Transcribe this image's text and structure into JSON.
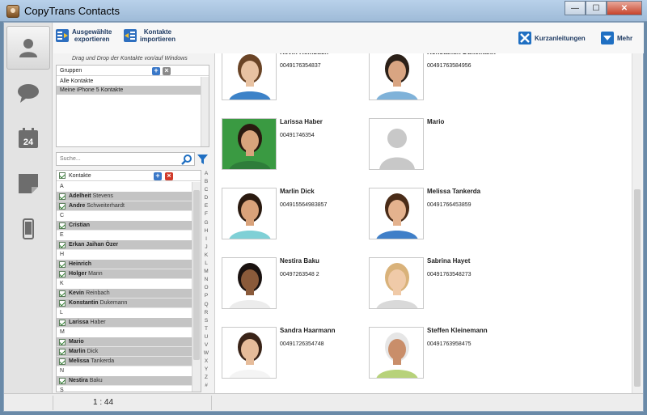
{
  "window": {
    "title": "CopyTrans Contacts"
  },
  "toolbar": {
    "export_line1": "Ausgewählte",
    "export_line2": "exportieren",
    "import_line1": "Kontakte",
    "import_line2": "importieren",
    "guides_label": "Kurzanleitungen",
    "more_label": "Mehr"
  },
  "panel": {
    "hint": "Drag und Drop der Kontakte von/auf Windows",
    "groups_header": "Gruppen",
    "groups": [
      "Alle Kontakte",
      "Meine iPhone 5 Kontakte"
    ],
    "search_placeholder": "Suche...",
    "contacts_header": "Kontakte"
  },
  "contact_list": [
    {
      "type": "letter",
      "text": "A"
    },
    {
      "type": "contact",
      "first": "Adelheit",
      "last": "Stevens"
    },
    {
      "type": "contact",
      "first": "Andre",
      "last": "Schweiterhardt"
    },
    {
      "type": "letter",
      "text": "C"
    },
    {
      "type": "contact",
      "first": "Cristian",
      "last": ""
    },
    {
      "type": "letter",
      "text": "E"
    },
    {
      "type": "contact",
      "first": "Erkan Jaihan Özer",
      "last": ""
    },
    {
      "type": "letter",
      "text": "H"
    },
    {
      "type": "contact",
      "first": "Heinrich",
      "last": ""
    },
    {
      "type": "contact",
      "first": "Holger",
      "last": "Mann"
    },
    {
      "type": "letter",
      "text": "K"
    },
    {
      "type": "contact",
      "first": "Kevin",
      "last": "Reinbach"
    },
    {
      "type": "contact",
      "first": "Konstantin",
      "last": "Dukemann"
    },
    {
      "type": "letter",
      "text": "L"
    },
    {
      "type": "contact",
      "first": "Larissa",
      "last": "Haber"
    },
    {
      "type": "letter",
      "text": "M"
    },
    {
      "type": "contact",
      "first": "Mario",
      "last": ""
    },
    {
      "type": "contact",
      "first": "Marlin",
      "last": "Dick"
    },
    {
      "type": "contact",
      "first": "Melissa",
      "last": "Tankerda"
    },
    {
      "type": "letter",
      "text": "N"
    },
    {
      "type": "contact",
      "first": "Nestira",
      "last": "Baku"
    },
    {
      "type": "letter",
      "text": "S"
    }
  ],
  "alphabet": [
    "A",
    "B",
    "C",
    "D",
    "E",
    "F",
    "G",
    "H",
    "I",
    "J",
    "K",
    "L",
    "M",
    "N",
    "O",
    "P",
    "Q",
    "R",
    "S",
    "T",
    "U",
    "V",
    "W",
    "X",
    "Y",
    "Z",
    "#"
  ],
  "cards": [
    {
      "name": "Kevin Reinbach",
      "phone": "0049176354837",
      "shirt": "#3c82c8",
      "hair": "#6a4426",
      "skin": "#e8c2a2",
      "bg": "#ffffff",
      "placeholder": false
    },
    {
      "name": "Konstantin Dukemann",
      "phone": "00491763584956",
      "shirt": "#7fb2d9",
      "hair": "#2b2018",
      "skin": "#d9a582",
      "bg": "#ffffff",
      "placeholder": false
    },
    {
      "name": "Larissa Haber",
      "phone": "00491746354",
      "shirt": "#2e7d3a",
      "hair": "#2a1a10",
      "skin": "#d8a47c",
      "bg": "#3a9a42",
      "placeholder": false
    },
    {
      "name": "Mario",
      "phone": "",
      "shirt": "#cfcfcf",
      "hair": "#cfcfcf",
      "skin": "#cfcfcf",
      "bg": "#ffffff",
      "placeholder": true
    },
    {
      "name": "Marlin Dick",
      "phone": "004915564983857",
      "shirt": "#7fd0d6",
      "hair": "#2a1a10",
      "skin": "#d9a27a",
      "bg": "#ffffff",
      "placeholder": false
    },
    {
      "name": "Melissa Tankerda",
      "phone": "00491766453859",
      "shirt": "#3f7fc8",
      "hair": "#4a2c18",
      "skin": "#e4b28e",
      "bg": "#ffffff",
      "placeholder": false
    },
    {
      "name": "Nestira Baku",
      "phone": "00497263548 2",
      "shirt": "#ececec",
      "hair": "#1a1210",
      "skin": "#8a5a3a",
      "bg": "#ffffff",
      "placeholder": false
    },
    {
      "name": "Sabrina Hayet",
      "phone": "00491763548273",
      "shirt": "#d9d9d9",
      "hair": "#d9b27a",
      "skin": "#f0caa8",
      "bg": "#ffffff",
      "placeholder": false
    },
    {
      "name": "Sandra Haarmann",
      "phone": "00491726354748",
      "shirt": "#f4f4f4",
      "hair": "#3a2418",
      "skin": "#e6bc9a",
      "bg": "#ffffff",
      "placeholder": false
    },
    {
      "name": "Steffen Kleinemann",
      "phone": "00491763958475",
      "shirt": "#b7d27a",
      "hair": "#e6e6e6",
      "skin": "#c98e6a",
      "bg": "#ffffff",
      "placeholder": false
    }
  ],
  "status": {
    "timer": "1 : 44"
  },
  "colors": {
    "accent": "#1f6fc2",
    "selected_row": "#c4c4c4",
    "danger": "#d03a2a"
  }
}
